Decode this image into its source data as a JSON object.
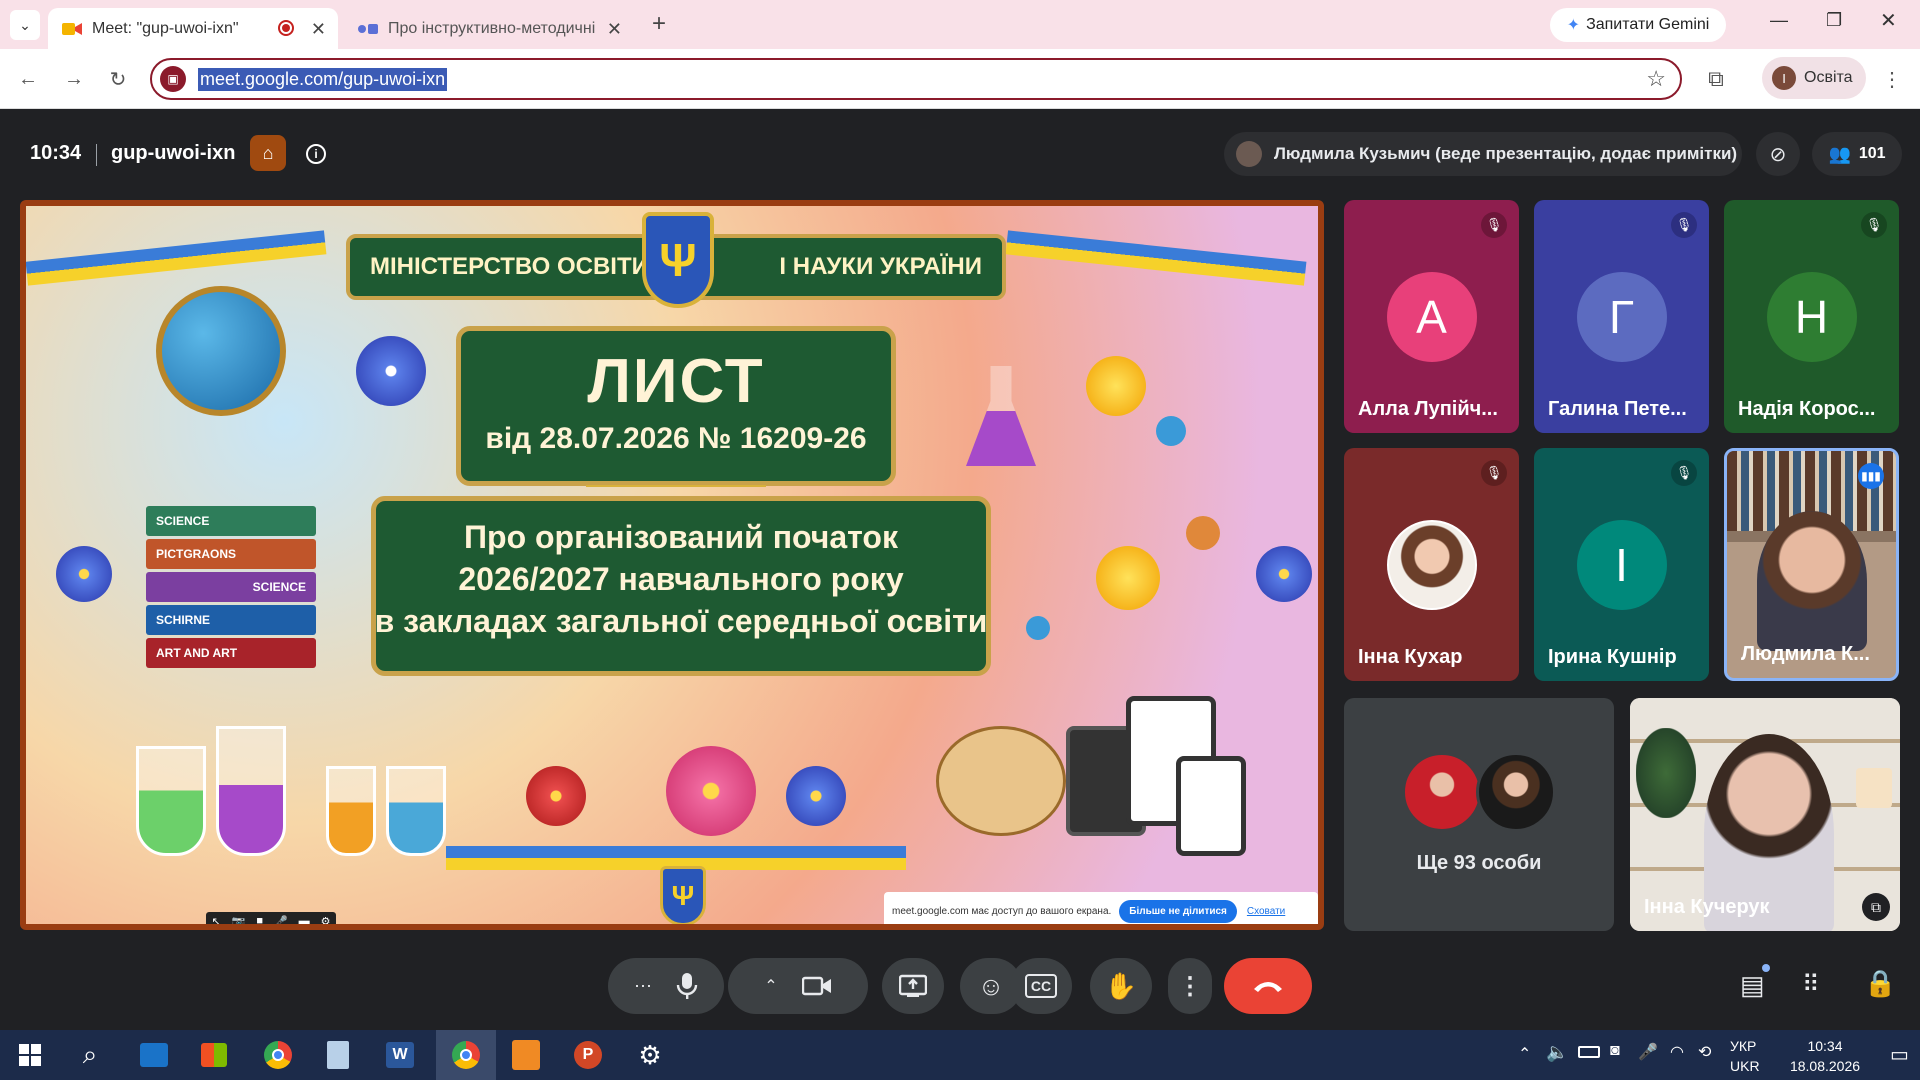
{
  "browser": {
    "tabs": [
      {
        "title": "Meet: \"gup-uwoi-ixn\"",
        "active": true
      },
      {
        "title": "Про інструктивно-методичні р",
        "active": false
      }
    ],
    "gemini_label": "Запитати Gemini",
    "url": "meet.google.com/gup-uwoi-ixn",
    "profile_initial": "I",
    "profile_label": "Освіта"
  },
  "meet": {
    "time": "10:34",
    "meeting_code": "gup-uwoi-ixn",
    "presenter_label": "Людмила Кузьмич (веде презентацію, додає примітки)",
    "participant_count": "101",
    "slide": {
      "header_left": "МІНІСТЕРСТВО ОСВІТИ",
      "header_right": "І НАУКИ УКРАЇНИ",
      "title": "ЛИСТ",
      "subtitle": "від 28.07.2026 № 16209-26",
      "body_lines": [
        "Про організований початок",
        "2026/2027 навчального року",
        "в закладах загальної середньої освіти"
      ],
      "book_labels": [
        "SCIENCE",
        "PICTGRAONS",
        "SCIENCE",
        "SCHIRNE",
        "ART AND ART"
      ]
    },
    "share_banner": {
      "text": "meet.google.com має доступ до вашого екрана.",
      "stop_label": "Більше не ділитися",
      "hide_label": "Сховати"
    },
    "participants": [
      {
        "name": "Алла Лупійч...",
        "initial": "А",
        "bg": "#8e1e4e",
        "avatar": "#e8407a"
      },
      {
        "name": "Галина Пете...",
        "initial": "Г",
        "bg": "#3a3fa0",
        "avatar": "#5c6bc0"
      },
      {
        "name": "Надія Корос...",
        "initial": "Н",
        "bg": "#1f5a2a",
        "avatar": "#2e7d32"
      },
      {
        "name": "Інна Кухар",
        "initial": "",
        "bg": "#7a2a2a",
        "avatar": "#ccc"
      },
      {
        "name": "Ірина Кушнір",
        "initial": "І",
        "bg": "#0b5a55",
        "avatar": "#00897b"
      },
      {
        "name": "Людмила К...",
        "initial": "",
        "bg": "#9c8a7a",
        "avatar": ""
      }
    ],
    "more_label": "Ще 93 особи",
    "self_name": "Інна Кучерук"
  },
  "taskbar": {
    "lang_top": "УКР",
    "lang_bottom": "UKR",
    "clock_time": "10:34",
    "clock_date": "18.08.2026"
  }
}
